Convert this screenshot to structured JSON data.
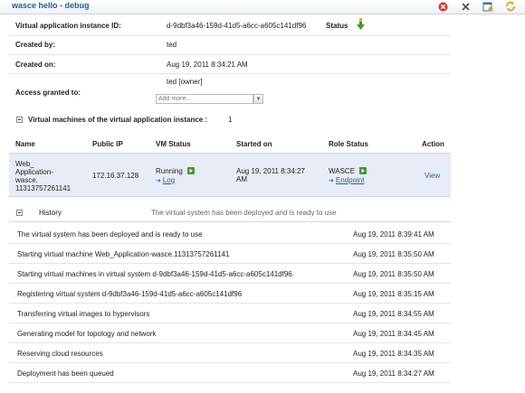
{
  "window": {
    "title": "wasce hello - debug",
    "icons": [
      "stop-icon",
      "delete-icon",
      "edit-icon",
      "refresh-icon"
    ]
  },
  "details": {
    "instance_id_label": "Virtual application instance ID:",
    "instance_id_value": "d-9dbf3a46-159d-41d5-a6cc-a605c141df96",
    "status_label": "Status",
    "created_by_label": "Created by:",
    "created_by_value": "ted",
    "created_on_label": "Created on:",
    "created_on_value": "Aug 19, 2011 8:34:21 AM",
    "access_label": "Access granted to:",
    "access_value": "ted [owner]",
    "access_placeholder": "Add more..."
  },
  "vm_section": {
    "title": "Virtual machines of the virtual application instance :",
    "count": "1",
    "columns": [
      "Name",
      "Public IP",
      "VM Status",
      "Started on",
      "Role Status",
      "Action"
    ],
    "rows": [
      {
        "name_lines": [
          "Web_",
          "Application-",
          "wasce.",
          "11313757261141"
        ],
        "public_ip": "172.16.37.128",
        "vm_status": "Running",
        "vm_link": "Log",
        "started_on": [
          "Aug 19, 2011 8:34:27",
          "AM"
        ],
        "role_status": "WASCE",
        "role_link": "Endpoint",
        "action": "View"
      }
    ]
  },
  "history": {
    "title": "History",
    "status_message": "The virtual system has been deployed and is ready to use",
    "entries": [
      {
        "message": "The virtual system has been deployed and is ready to use",
        "time": "Aug 19, 2011 8:39:41 AM"
      },
      {
        "message": "Starting virtual machine Web_Application-wasce.11313757261141",
        "time": "Aug 19, 2011 8:35:50 AM"
      },
      {
        "message": "Starting virtual machines in virtual system d-9dbf3a46-159d-41d5-a6cc-a605c141df96.",
        "time": "Aug 19, 2011 8:35:50 AM"
      },
      {
        "message": "Registering virtual system d-9dbf3a46-159d-41d5-a6cc-a605c141df96",
        "time": "Aug 19, 2011 8:35:15 AM"
      },
      {
        "message": "Transferring virtual images to hypervisors",
        "time": "Aug 19, 2011 8:34:55 AM"
      },
      {
        "message": "Generating model for topology and network",
        "time": "Aug 19, 2011 8:34:45 AM"
      },
      {
        "message": "Reserving cloud resources",
        "time": "Aug 19, 2011 8:34:35 AM"
      },
      {
        "message": "Deployment has been queued",
        "time": "Aug 19, 2011 8:34:27 AM"
      }
    ]
  },
  "colors": {
    "title": "#1e5f9a",
    "link": "#2a62a8",
    "row_highlight": "#e8ecf6",
    "running_green": "#3e9a2e"
  }
}
